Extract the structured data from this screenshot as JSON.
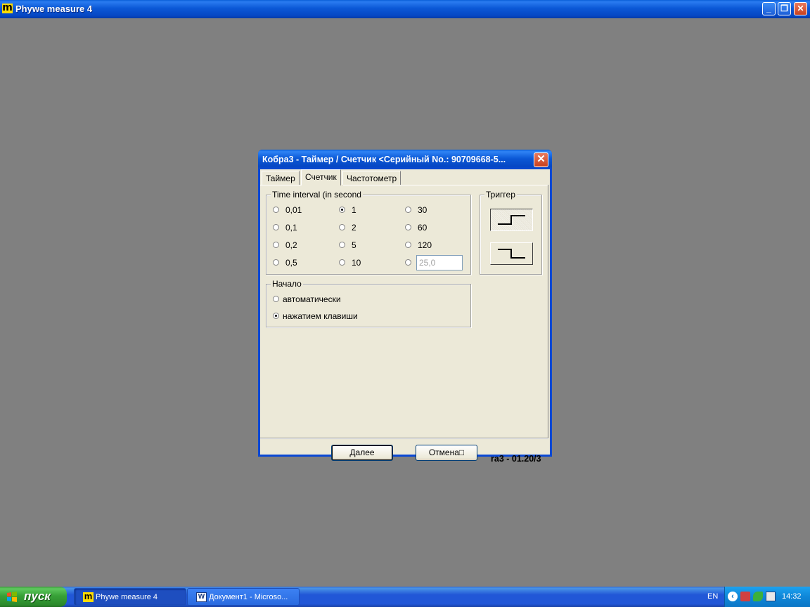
{
  "app": {
    "title": "Phywe measure 4",
    "logo_letter": "m",
    "controls": {
      "minimize": "_",
      "restore": "❐",
      "close": "✕"
    }
  },
  "dialog": {
    "title": "Кобра3 - Таймер / Счетчик  <Серийный No.: 90709668-5...",
    "close": "✕",
    "tabs": [
      {
        "label": "Таймер",
        "active": false
      },
      {
        "label": "Счетчик",
        "active": true
      },
      {
        "label": "Частотометр",
        "active": false
      }
    ],
    "interval_group": {
      "title": "Time interval (in second",
      "options": [
        {
          "label": "0,01",
          "selected": false
        },
        {
          "label": "1",
          "selected": true
        },
        {
          "label": "30",
          "selected": false
        },
        {
          "label": "0,1",
          "selected": false
        },
        {
          "label": "2",
          "selected": false
        },
        {
          "label": "60",
          "selected": false
        },
        {
          "label": "0,2",
          "selected": false
        },
        {
          "label": "5",
          "selected": false
        },
        {
          "label": "120",
          "selected": false
        },
        {
          "label": "0,5",
          "selected": false
        },
        {
          "label": "10",
          "selected": false
        }
      ],
      "custom_value": "25,0"
    },
    "trigger_group": {
      "title": "Триггер",
      "buttons": [
        {
          "name": "rising-edge",
          "active": true
        },
        {
          "name": "falling-edge",
          "active": false
        }
      ]
    },
    "start_group": {
      "title": "Начало",
      "options": [
        {
          "label": "автоматически",
          "selected": false
        },
        {
          "label": "нажатием клавиши",
          "selected": true
        }
      ]
    },
    "next_button": "Далее",
    "cancel_button": "Отмена",
    "cancel_suffix": "□",
    "version": "ra3 - 01.20/3"
  },
  "taskbar": {
    "start_label": "пуск",
    "tasks": [
      {
        "label": "Phywe measure 4",
        "active": true
      },
      {
        "label": "Документ1 - Microso...",
        "active": false
      }
    ],
    "language": "EN",
    "clock": "14:32"
  },
  "colors": {
    "desktop": "#808080",
    "dialog_face": "#ece9d8",
    "titlebar_blue": "#0b58d6",
    "close_red": "#c8401e",
    "start_green": "#37a137"
  }
}
